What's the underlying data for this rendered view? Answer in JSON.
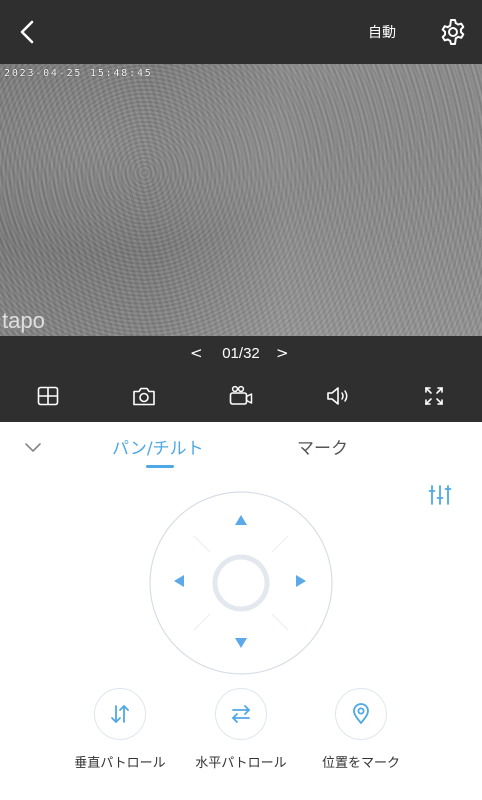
{
  "header": {
    "mode_label": "自動",
    "back_icon": "chevron-left-icon",
    "settings_icon": "gear-icon"
  },
  "video": {
    "timestamp": "2023-04-25 15:48:45",
    "watermark": "tapo"
  },
  "pager": {
    "prev": "<",
    "count": "01/32",
    "next": ">"
  },
  "toolbar": {
    "icons": [
      "grid-icon",
      "camera-icon",
      "record-icon",
      "speaker-icon",
      "fullscreen-icon"
    ]
  },
  "tabs": {
    "pan_tilt": "パン/チルト",
    "mark": "マーク",
    "active_color": "#4ea8e6"
  },
  "actions": {
    "vertical_patrol": "垂直パトロール",
    "horizontal_patrol": "水平パトロール",
    "mark_position": "位置をマーク"
  }
}
